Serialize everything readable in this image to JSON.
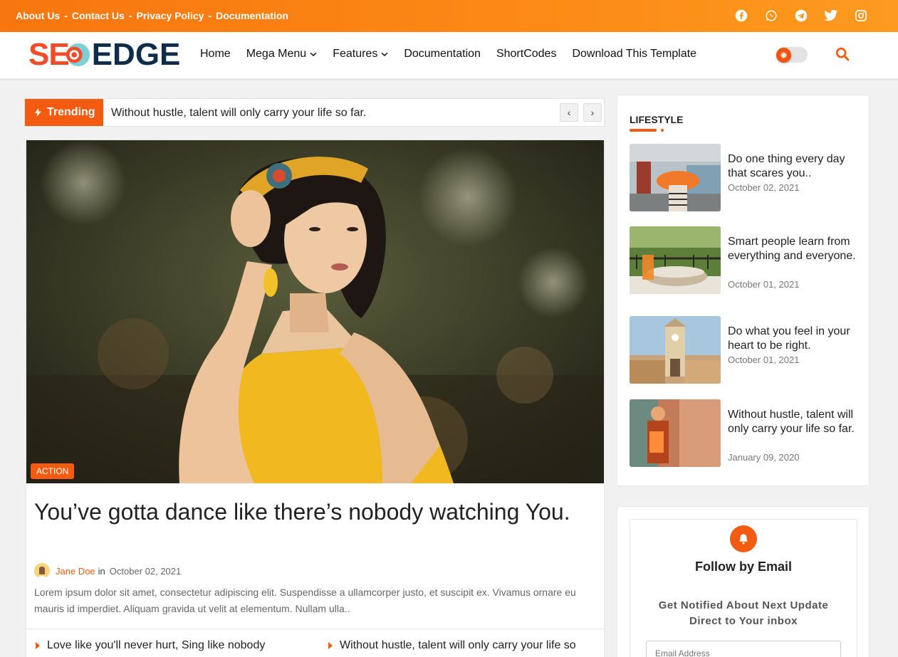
{
  "topbar": {
    "links": [
      "About Us",
      "Contact Us",
      "Privacy Policy",
      "Documentation"
    ],
    "separator": "-",
    "social_icons": [
      "facebook-icon",
      "whatsapp-icon",
      "telegram-icon",
      "twitter-icon",
      "instagram-icon"
    ]
  },
  "header": {
    "logo_left": "SE",
    "logo_right": "EDGE",
    "nav": [
      {
        "label": "Home"
      },
      {
        "label": "Mega Menu",
        "dropdown": true
      },
      {
        "label": "Features",
        "dropdown": true
      },
      {
        "label": "Documentation"
      },
      {
        "label": "ShortCodes"
      },
      {
        "label": "Download This Template"
      }
    ]
  },
  "trending": {
    "label": "Trending",
    "text": "Without hustle, talent will only carry your life so far.",
    "prev": "‹",
    "next": "›"
  },
  "featured": {
    "badge": "ACTION",
    "title": "You’ve gotta dance like there’s nobody watching You.",
    "author": "Jane Doe",
    "in": "in",
    "date": "October 02, 2021",
    "excerpt": "Lorem ipsum dolor sit amet, consectetur adipiscing elit. Suspendisse a ullamcorper justo, et suscipit ex. Vivamus ornare eu mauris id imperdiet. Aliquam gravida ut velit at elementum. Nullam ulla..",
    "related": [
      "Love like you'll never hurt, Sing like nobody",
      "Without hustle, talent will only carry your life so"
    ]
  },
  "lifestyle": {
    "title": "LIFESTYLE",
    "posts": [
      {
        "title": "Do one thing every day that scares you..",
        "date": "October 02, 2021"
      },
      {
        "title": "Smart people learn from everything and everyone.",
        "date": "October 01, 2021"
      },
      {
        "title": "Do what you feel in your heart to be right.",
        "date": "October 01, 2021"
      },
      {
        "title": "Without hustle, talent will only carry your life so far.",
        "date": "January 09, 2020"
      }
    ]
  },
  "follow": {
    "title": "Follow by Email",
    "subtitle": "Get Notified About Next Update Direct to Your inbox",
    "placeholder": "Email Address"
  },
  "colors": {
    "accent": "#f35b10",
    "topbar": "#fc8a16",
    "logo_dark": "#0f2c4a"
  }
}
